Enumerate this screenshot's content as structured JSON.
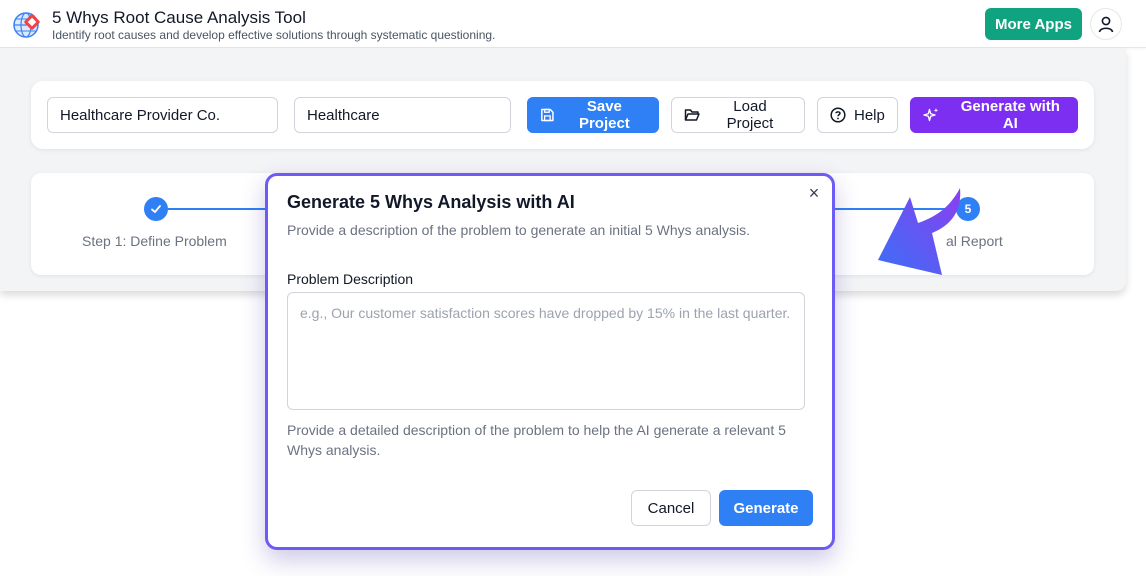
{
  "header": {
    "title": "5 Whys Root Cause Analysis Tool",
    "subtitle": "Identify root causes and develop effective solutions through systematic questioning.",
    "more_apps_label": "More Apps",
    "logo_icon": "globe-logo-icon",
    "user_icon": "user-icon"
  },
  "toolbar": {
    "company_value": "Healthcare Provider Co.",
    "industry_value": "Healthcare",
    "save_label": "Save Project",
    "load_label": "Load Project",
    "help_label": "Help",
    "generate_ai_label": "Generate with AI"
  },
  "steps": {
    "step1_label": "Step 1: Define Problem",
    "step5_number": "5",
    "step5_label_visible": "al Report"
  },
  "modal": {
    "title": "Generate 5 Whys Analysis with AI",
    "subtitle": "Provide a description of the problem to generate an initial 5 Whys analysis.",
    "close_glyph": "×",
    "field_label": "Problem Description",
    "placeholder": "e.g., Our customer satisfaction scores have dropped by 15% in the last quarter.",
    "help_text": "Provide a detailed description of the problem to help the AI generate a relevant 5 Whys analysis.",
    "cancel_label": "Cancel",
    "generate_label": "Generate"
  },
  "colors": {
    "primary_blue": "#2f7ff5",
    "ai_purple": "#7c2ff0",
    "more_apps_green": "#10a37f",
    "modal_border": "#6d5bf5"
  }
}
